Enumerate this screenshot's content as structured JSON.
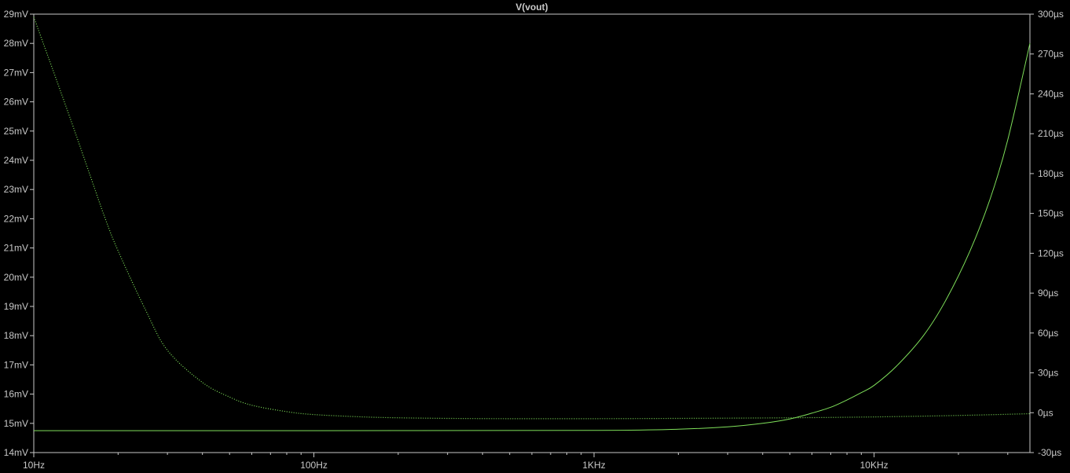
{
  "colors": {
    "background": "#000000",
    "frame": "#c8c8c8",
    "text": "#c8c8c8",
    "trace": "#7fe05a",
    "title": "#4ee34e"
  },
  "chart_data": {
    "type": "line",
    "title": "V(vout)",
    "xlabel": "",
    "ylabel_left": "",
    "ylabel_right": "",
    "x_scale": "log",
    "grid": false,
    "xlim": [
      10,
      36000
    ],
    "ylim_left": [
      14,
      29
    ],
    "ylim_right": [
      -30,
      300
    ],
    "x_ticks": [
      {
        "value": 10,
        "label": "10Hz"
      },
      {
        "value": 100,
        "label": "100Hz"
      },
      {
        "value": 1000,
        "label": "1KHz"
      },
      {
        "value": 10000,
        "label": "10KHz"
      }
    ],
    "y_ticks_left": [
      {
        "value": 14,
        "label": "14mV"
      },
      {
        "value": 15,
        "label": "15mV"
      },
      {
        "value": 16,
        "label": "16mV"
      },
      {
        "value": 17,
        "label": "17mV"
      },
      {
        "value": 18,
        "label": "18mV"
      },
      {
        "value": 19,
        "label": "19mV"
      },
      {
        "value": 20,
        "label": "20mV"
      },
      {
        "value": 21,
        "label": "21mV"
      },
      {
        "value": 22,
        "label": "22mV"
      },
      {
        "value": 23,
        "label": "23mV"
      },
      {
        "value": 24,
        "label": "24mV"
      },
      {
        "value": 25,
        "label": "25mV"
      },
      {
        "value": 26,
        "label": "26mV"
      },
      {
        "value": 27,
        "label": "27mV"
      },
      {
        "value": 28,
        "label": "28mV"
      },
      {
        "value": 29,
        "label": "29mV"
      }
    ],
    "y_ticks_right": [
      {
        "value": -30,
        "label": "-30µs"
      },
      {
        "value": 0,
        "label": "0µs"
      },
      {
        "value": 30,
        "label": "30µs"
      },
      {
        "value": 60,
        "label": "60µs"
      },
      {
        "value": 90,
        "label": "90µs"
      },
      {
        "value": 120,
        "label": "120µs"
      },
      {
        "value": 150,
        "label": "150µs"
      },
      {
        "value": 180,
        "label": "180µs"
      },
      {
        "value": 210,
        "label": "210µs"
      },
      {
        "value": 240,
        "label": "240µs"
      },
      {
        "value": 270,
        "label": "270µs"
      },
      {
        "value": 300,
        "label": "300µs"
      }
    ],
    "series": [
      {
        "axis": "left",
        "style": "solid",
        "x": [
          10,
          100,
          1000,
          2000,
          3000,
          4000,
          5000,
          6000,
          7000,
          8000,
          9000,
          10000,
          12000,
          15000,
          18000,
          22000,
          26000,
          30000,
          36000
        ],
        "y": [
          14.75,
          14.75,
          14.76,
          14.8,
          14.88,
          15.0,
          15.15,
          15.35,
          15.55,
          15.8,
          16.05,
          16.3,
          16.95,
          18.0,
          19.2,
          20.9,
          22.7,
          24.7,
          28.0
        ]
      },
      {
        "axis": "left",
        "style": "dotted",
        "x": [
          10,
          12,
          14,
          16,
          18,
          20,
          25,
          30,
          40,
          50,
          60,
          80,
          100,
          150,
          200,
          300,
          500,
          1000,
          2000,
          5000,
          10000,
          20000,
          36000
        ],
        "y": [
          28.9,
          26.8,
          25.0,
          23.4,
          22.0,
          20.9,
          18.9,
          17.5,
          16.4,
          15.9,
          15.62,
          15.4,
          15.3,
          15.22,
          15.19,
          15.17,
          15.16,
          15.16,
          15.17,
          15.19,
          15.22,
          15.27,
          15.33
        ]
      }
    ]
  }
}
